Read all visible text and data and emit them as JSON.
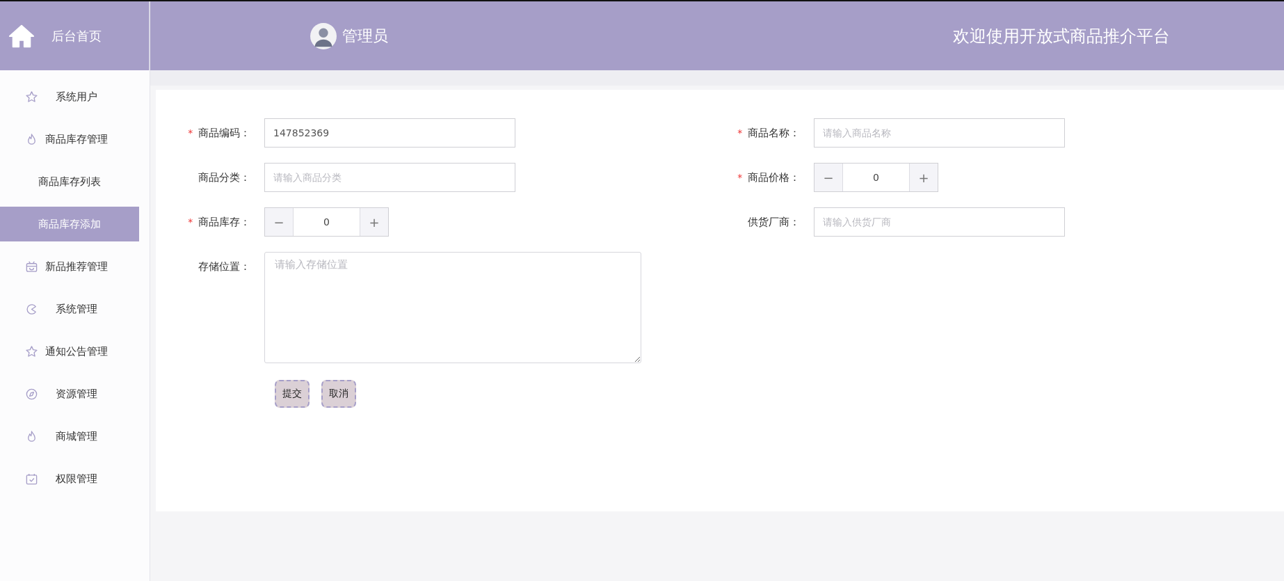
{
  "sidebar": {
    "title": "后台首页",
    "items": [
      {
        "label": "系统用户",
        "selected": false
      },
      {
        "label": "商品库存管理",
        "selected": false,
        "children": [
          {
            "label": "商品库存列表",
            "selected": false
          },
          {
            "label": "商品库存添加",
            "selected": true
          }
        ]
      },
      {
        "label": "新品推荐管理",
        "selected": false
      },
      {
        "label": "系统管理",
        "selected": false
      },
      {
        "label": "通知公告管理",
        "selected": false
      },
      {
        "label": "资源管理",
        "selected": false
      },
      {
        "label": "商城管理",
        "selected": false
      },
      {
        "label": "权限管理",
        "selected": false
      }
    ]
  },
  "header": {
    "user": "管理员",
    "welcome": "欢迎使用开放式商品推介平台"
  },
  "form": {
    "rows": [
      [
        {
          "kind": "text",
          "label": "商品编码：",
          "required": true,
          "value": "147852369"
        },
        {
          "kind": "text",
          "label": "商品名称：",
          "required": true,
          "placeholder": "请输入商品名称"
        }
      ],
      [
        {
          "kind": "text",
          "label": "商品分类：",
          "required": false,
          "placeholder": "请输入商品分类"
        },
        {
          "kind": "number",
          "label": "商品价格：",
          "required": true,
          "value": "0",
          "minus": "−",
          "plus": "+"
        }
      ],
      [
        {
          "kind": "number",
          "label": "商品库存：",
          "required": true,
          "value": "0",
          "minus": "−",
          "plus": "+"
        },
        {
          "kind": "text",
          "label": "供货厂商：",
          "required": false,
          "placeholder": "请输入供货厂商"
        }
      ],
      [
        {
          "kind": "textarea",
          "label": "存储位置：",
          "required": false,
          "placeholder": "请输入存储位置"
        }
      ]
    ],
    "required_mark": "*",
    "buttons": [
      "提交",
      "取消"
    ]
  }
}
